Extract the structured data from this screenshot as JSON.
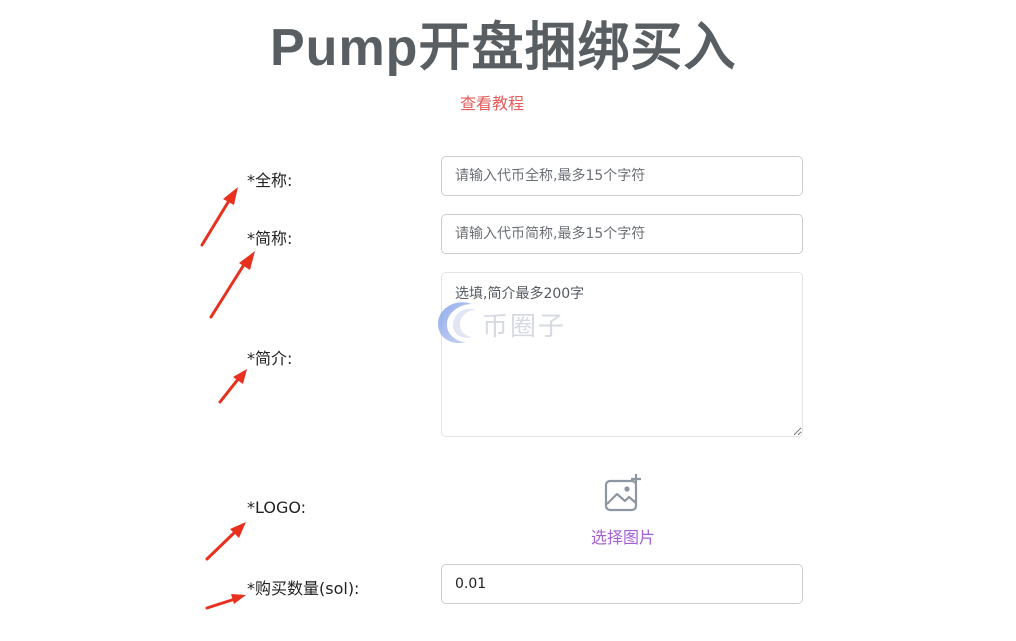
{
  "header": {
    "title": "Pump开盘捆绑买入",
    "tutorial_link": "查看教程"
  },
  "form": {
    "full_name": {
      "label": "*全称:",
      "placeholder": "请输入代币全称,最多15个字符",
      "value": ""
    },
    "short_name": {
      "label": "*简称:",
      "placeholder": "请输入代币简称,最多15个字符",
      "value": ""
    },
    "intro": {
      "label": "*简介:",
      "placeholder": "选填,简介最多200字",
      "value": ""
    },
    "logo": {
      "label": "*LOGO:",
      "upload_label": "选择图片",
      "icon": "add-image-icon"
    },
    "buy_amount": {
      "label": "*购买数量(sol):",
      "value": "0.01"
    }
  },
  "watermark": {
    "text": "币圈子"
  },
  "colors": {
    "title": "#595e63",
    "tutorial_link": "#e65b5b",
    "upload_label": "#a35fd6",
    "annotation_arrow": "#e8301e"
  }
}
